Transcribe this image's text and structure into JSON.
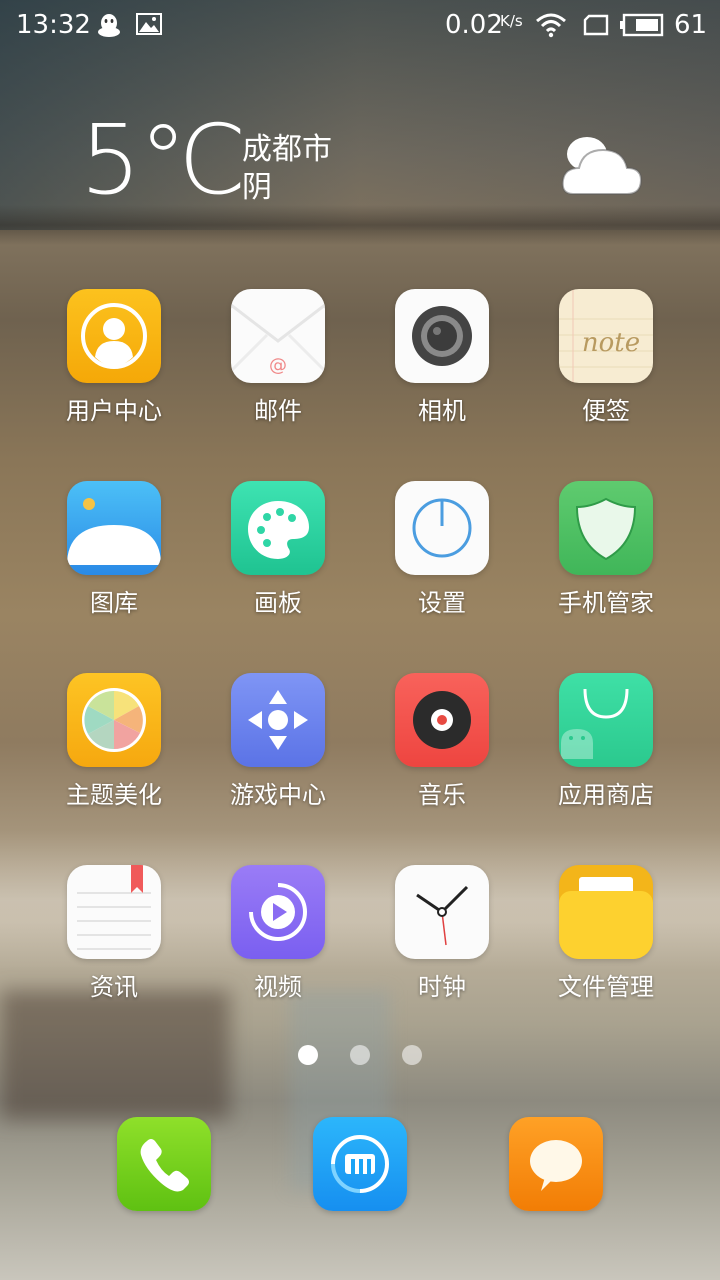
{
  "status_bar": {
    "time": "13:32",
    "net_speed": "0.02",
    "net_unit": "K/s",
    "battery_level": "61",
    "icons": [
      "qq-icon",
      "image-icon",
      "wifi-icon",
      "sim-icon",
      "battery-icon"
    ]
  },
  "weather": {
    "temperature": "5℃",
    "city": "成都市",
    "condition": "阴",
    "icon": "cloud-icon"
  },
  "apps": [
    {
      "label": "用户中心",
      "icon": "user-center-icon"
    },
    {
      "label": "邮件",
      "icon": "mail-icon"
    },
    {
      "label": "相机",
      "icon": "camera-icon"
    },
    {
      "label": "便签",
      "icon": "note-icon",
      "icon_text": "note"
    },
    {
      "label": "图库",
      "icon": "gallery-icon"
    },
    {
      "label": "画板",
      "icon": "palette-icon"
    },
    {
      "label": "设置",
      "icon": "settings-icon"
    },
    {
      "label": "手机管家",
      "icon": "phone-manager-icon"
    },
    {
      "label": "主题美化",
      "icon": "theme-icon"
    },
    {
      "label": "游戏中心",
      "icon": "game-center-icon"
    },
    {
      "label": "音乐",
      "icon": "music-icon"
    },
    {
      "label": "应用商店",
      "icon": "app-store-icon"
    },
    {
      "label": "资讯",
      "icon": "news-icon"
    },
    {
      "label": "视频",
      "icon": "video-icon"
    },
    {
      "label": "时钟",
      "icon": "clock-icon"
    },
    {
      "label": "文件管理",
      "icon": "file-manager-icon"
    }
  ],
  "page_indicator": {
    "count": 3,
    "active": 0
  },
  "dock": [
    {
      "icon": "phone-icon"
    },
    {
      "icon": "browser-icon"
    },
    {
      "icon": "messages-icon"
    }
  ],
  "colors": {
    "user_center": "#f8b514",
    "gallery": "#3aa9f0",
    "palette": "#2fd6a6",
    "phone_manager": "#4ec06a",
    "theme": "#f9b61b",
    "game_center": "#6f86ee",
    "music": "#f4524b",
    "app_store": "#36d59c",
    "video": "#8a6cf2",
    "files": "#fdc72a",
    "dock_phone": "#78d21e",
    "dock_browser": "#1aa4f6",
    "dock_messages": "#f88b0d"
  }
}
